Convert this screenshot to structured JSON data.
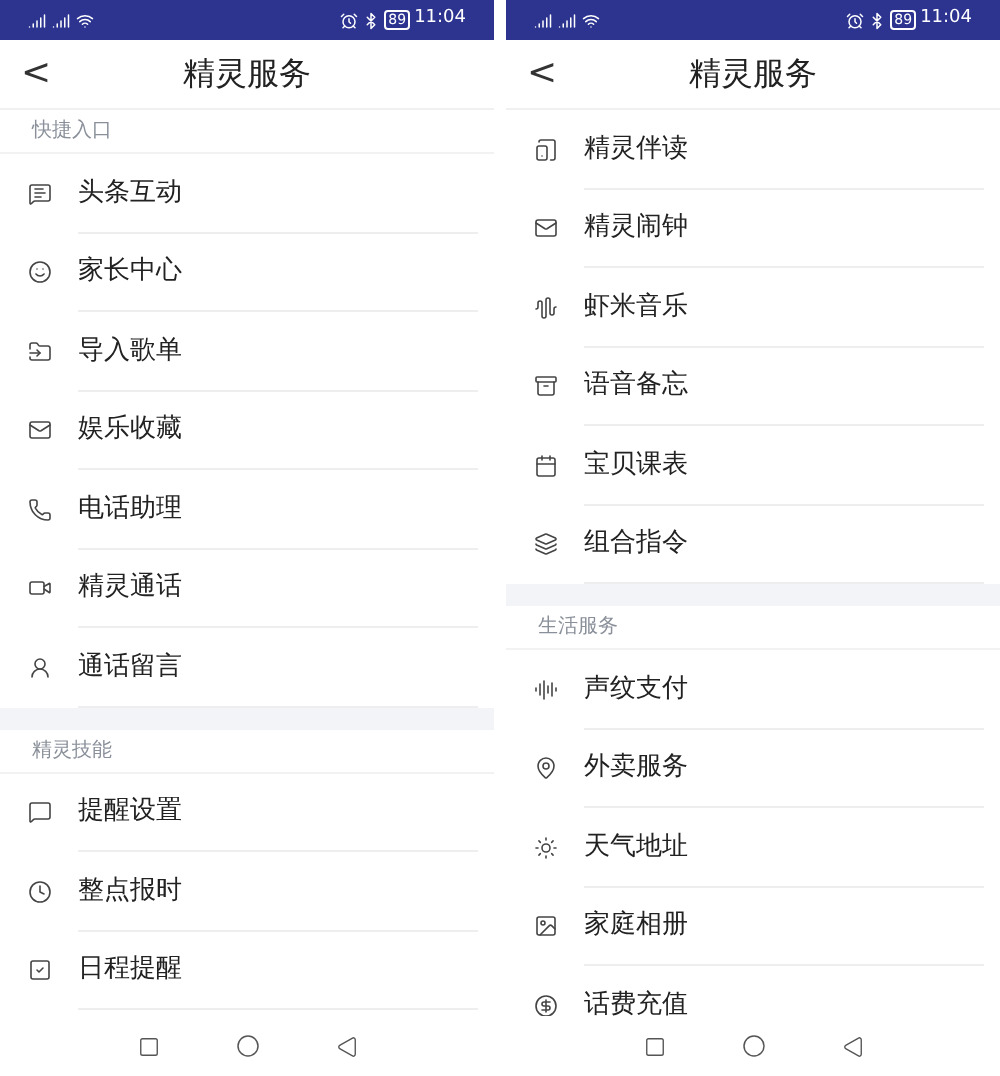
{
  "screens": [
    {
      "status_bar": {
        "battery": "89",
        "time": "11:04"
      },
      "header": {
        "back": "<",
        "title": "精灵服务"
      },
      "list": [
        {
          "kind": "section",
          "label": "快捷入口"
        },
        {
          "kind": "item",
          "label": "头条互动"
        },
        {
          "kind": "item",
          "label": "家长中心"
        },
        {
          "kind": "item",
          "label": "导入歌单"
        },
        {
          "kind": "item",
          "label": "娱乐收藏"
        },
        {
          "kind": "item",
          "label": "电话助理"
        },
        {
          "kind": "item",
          "label": "精灵通话"
        },
        {
          "kind": "item",
          "label": "通话留言"
        },
        {
          "kind": "gap"
        },
        {
          "kind": "section",
          "label": "精灵技能"
        },
        {
          "kind": "item",
          "label": "提醒设置"
        },
        {
          "kind": "item",
          "label": "整点报时"
        },
        {
          "kind": "item",
          "label": "日程提醒"
        }
      ]
    },
    {
      "status_bar": {
        "battery": "89",
        "time": "11:04"
      },
      "header": {
        "back": "<",
        "title": "精灵服务"
      },
      "list": [
        {
          "kind": "item",
          "label": "精灵伴读"
        },
        {
          "kind": "item",
          "label": "精灵闹钟"
        },
        {
          "kind": "item",
          "label": "虾米音乐"
        },
        {
          "kind": "item",
          "label": "语音备忘"
        },
        {
          "kind": "item",
          "label": "宝贝课表"
        },
        {
          "kind": "item",
          "label": "组合指令"
        },
        {
          "kind": "gap"
        },
        {
          "kind": "section",
          "label": "生活服务"
        },
        {
          "kind": "item",
          "label": "声纹支付"
        },
        {
          "kind": "item",
          "label": "外卖服务"
        },
        {
          "kind": "item",
          "label": "天气地址"
        },
        {
          "kind": "item",
          "label": "家庭相册"
        },
        {
          "kind": "item",
          "label": "话费充值"
        }
      ]
    }
  ]
}
